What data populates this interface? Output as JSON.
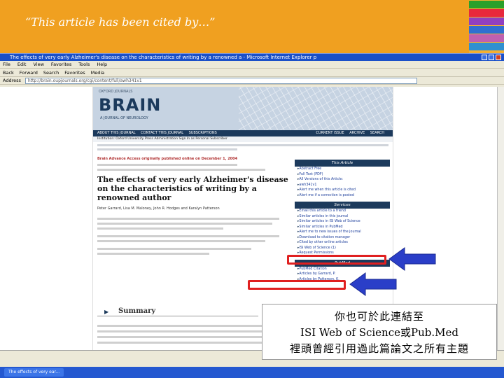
{
  "slide": {
    "title": "“This article has been cited by…”",
    "swatch_colors": [
      "#2aa02a",
      "#e8283c",
      "#9040c0",
      "#3070d0",
      "#c060b0",
      "#3090d0"
    ]
  },
  "browser": {
    "window_title": "The effects of very early Alzheimer's disease on the characteristics of writing by a renowned a - Microsoft Internet Explorer p",
    "menu": [
      "File",
      "Edit",
      "View",
      "Favorites",
      "Tools",
      "Help"
    ],
    "toolbar": [
      "Back",
      "Forward",
      "Search",
      "Favorites",
      "Media"
    ],
    "address_label": "Address",
    "address_value": "http://brain.oupjournals.org/cgi/content/full/awh341v1"
  },
  "page": {
    "publisher": "OXFORD JOURNALS",
    "journal_name": "BRAIN",
    "journal_subtitle": "A JOURNAL OF NEUROLOGY",
    "nav_left": [
      "ABOUT THIS JOURNAL",
      "CONTACT THIS JOURNAL",
      "SUBSCRIPTIONS"
    ],
    "nav_right": [
      "CURRENT ISSUE",
      "ARCHIVE",
      "SEARCH"
    ],
    "info_line": "Institution: Oxford University Press Administration  Sign In as Personal Subscriber",
    "advance_notice": "Brain Advance Access originally published online on December 1, 2004",
    "article_title": "The effects of very early Alzheimer's disease on the characteristics of writing by a renowned author",
    "authors": "Peter Garrard, Lisa M. Maloney, John R. Hodges and Karalyn Patterson",
    "summary_heading": "Summary",
    "sidebar": {
      "this_article_heading": "This Article",
      "this_article_items": [
        "Abstract Free",
        "Full Text (PDF)",
        "All Versions of this Article:",
        "awh341v1",
        "Alert me when this article is cited",
        "Alert me if a correction is posted"
      ],
      "services_heading": "Services",
      "services_items": [
        "Email this article to a friend",
        "Similar articles in this journal",
        "Similar articles in ISI Web of Science",
        "Similar articles in PubMed",
        "Alert me to new issues of the journal",
        "Download to citation manager",
        "Cited by other online articles",
        "ISI Web of Science (1)",
        "Request Permissions"
      ],
      "pubmed_heading": "PubMed",
      "pubmed_items": [
        "PubMed Citation",
        "Articles by Garrard, P.",
        "Articles by Patterson, K."
      ]
    }
  },
  "annotation": {
    "line1": "你也可於此連結至",
    "line2": "ISI Web of Science或Pub.Med",
    "line3": "裡頭曾經引用過此篇論文之所有主題"
  },
  "taskbar": {
    "items": [
      "The effects of very ear..."
    ]
  },
  "colors": {
    "header_orange": "#f0a020",
    "highlight_red": "#e02020",
    "arrow_blue": "#2a3ec8",
    "journal_navy": "#1c3a5c"
  }
}
